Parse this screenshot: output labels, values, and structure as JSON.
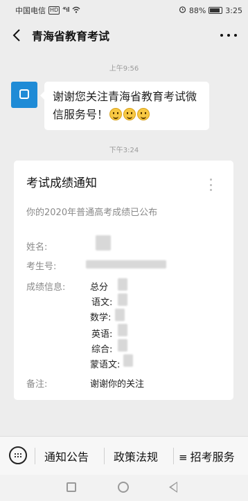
{
  "status_bar": {
    "carrier": "中国电信",
    "network_badge": "HD",
    "signal": "⁴⁶ıll",
    "battery_percent": "88%",
    "time": "3:25",
    "icons": [
      "alarm-icon",
      "battery-icon",
      "wifi-icon"
    ]
  },
  "header": {
    "title": "青海省教育考试",
    "back_icon": "chevron-left-icon",
    "more_icon": "ellipsis-icon"
  },
  "chat": {
    "timestamp_1": "上午9:56",
    "welcome_text": "谢谢您关注青海省教育考试微信服务号！",
    "emoji_count": 3,
    "timestamp_2": "下午3:24"
  },
  "card": {
    "title": "考试成绩通知",
    "subtitle": "你的2020年普通高考成绩已公布",
    "name_label": "姓名:",
    "exam_no_label": "考生号:",
    "score_info_label": "成绩信息:",
    "scores": [
      {
        "label": "总分"
      },
      {
        "label": "语文:"
      },
      {
        "label": "数学:"
      },
      {
        "label": "英语:"
      },
      {
        "label": "综合:"
      },
      {
        "label": "蒙语文:"
      }
    ],
    "remark_label": "备注:",
    "remark_value": "谢谢你的关注"
  },
  "bottom_menu": {
    "items": [
      "通知公告",
      "政策法规",
      "招考服务"
    ],
    "keyboard_icon": "keyboard-icon",
    "list_icon": "≡"
  },
  "nav_bar": {
    "icons": [
      "recent-apps-icon",
      "home-icon",
      "back-icon"
    ]
  }
}
